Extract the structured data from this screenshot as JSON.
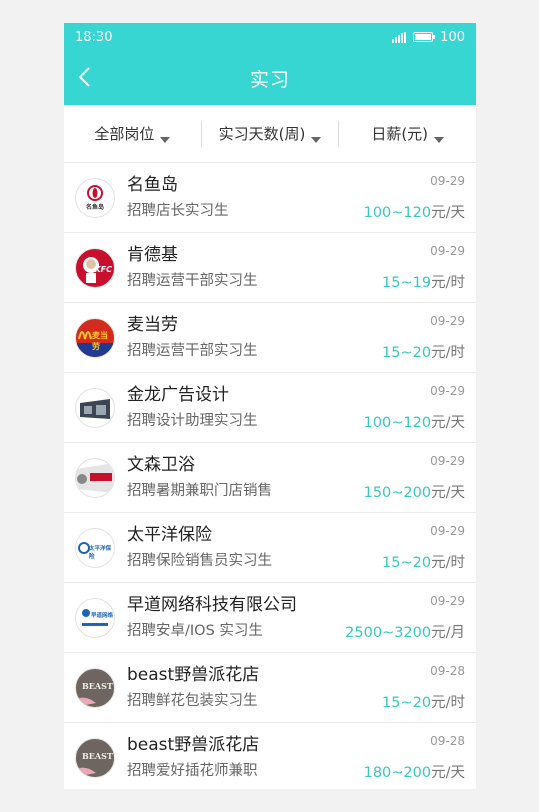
{
  "status_bar": {
    "time": "18:30",
    "battery": "100"
  },
  "header": {
    "title": "实习"
  },
  "filters": [
    {
      "label": "全部岗位"
    },
    {
      "label": "实习天数(周)"
    },
    {
      "label": "日薪(元)"
    }
  ],
  "listings": [
    {
      "company": "名鱼岛",
      "position": "招聘店长实习生",
      "date": "09-29",
      "pay": "100~120",
      "unit": "元/天",
      "logo": "mingyudao-logo",
      "logo_text": "名鱼岛"
    },
    {
      "company": "肯德基",
      "position": "招聘运营干部实习生",
      "date": "09-29",
      "pay": "15~19",
      "unit": "元/时",
      "logo": "kfc-logo",
      "logo_text": "KFC"
    },
    {
      "company": "麦当劳",
      "position": "招聘运营干部实习生",
      "date": "09-29",
      "pay": "15~20",
      "unit": "元/时",
      "logo": "mcdonalds-logo",
      "logo_text": "麦当劳"
    },
    {
      "company": "金龙广告设计",
      "position": "招聘设计助理实习生",
      "date": "09-29",
      "pay": "100~120",
      "unit": "元/天",
      "logo": "jinlong-logo",
      "logo_text": ""
    },
    {
      "company": "文森卫浴",
      "position": "招聘暑期兼职门店销售",
      "date": "09-29",
      "pay": "150~200",
      "unit": "元/天",
      "logo": "wensen-logo",
      "logo_text": ""
    },
    {
      "company": "太平洋保险",
      "position": "招聘保险销售员实习生",
      "date": "09-29",
      "pay": "15~20",
      "unit": "元/时",
      "logo": "cpic-logo",
      "logo_text": "太平洋保险"
    },
    {
      "company": "早道网络科技有限公司",
      "position": "招聘安卓/IOS 实习生",
      "date": "09-29",
      "pay": "2500~3200",
      "unit": "元/月",
      "logo": "zaodao-logo",
      "logo_text": "早道网络"
    },
    {
      "company": "beast野兽派花店",
      "position": "招聘鲜花包装实习生",
      "date": "09-28",
      "pay": "15~20",
      "unit": "元/时",
      "logo": "beast-logo",
      "logo_text": "BEAST"
    },
    {
      "company": "beast野兽派花店",
      "position": "招聘爱好插花师兼职",
      "date": "09-28",
      "pay": "180~200",
      "unit": "元/天",
      "logo": "beast-logo",
      "logo_text": "BEAST"
    }
  ],
  "colors": {
    "accent": "#37d6d2",
    "pay": "#37c7c2"
  }
}
